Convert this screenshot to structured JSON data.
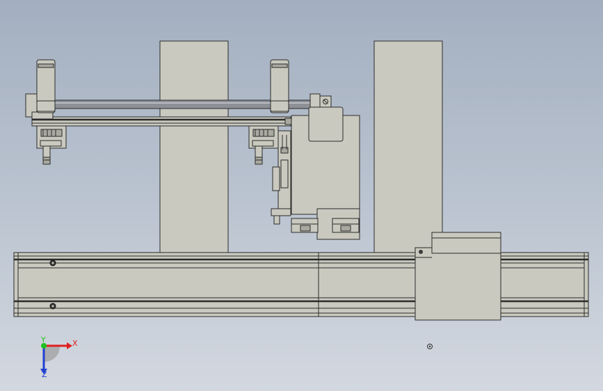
{
  "triad": {
    "x_label": "X",
    "y_label": "Y",
    "z_label": "Z",
    "x_color": "#e02020",
    "y_color": "#20c020",
    "z_color": "#2040d0"
  },
  "colors": {
    "part_fill": "#c9c9bf",
    "edge": "#2b2b2b",
    "background_top": "#a3afc0",
    "background_bottom": "#d3d8e0"
  }
}
